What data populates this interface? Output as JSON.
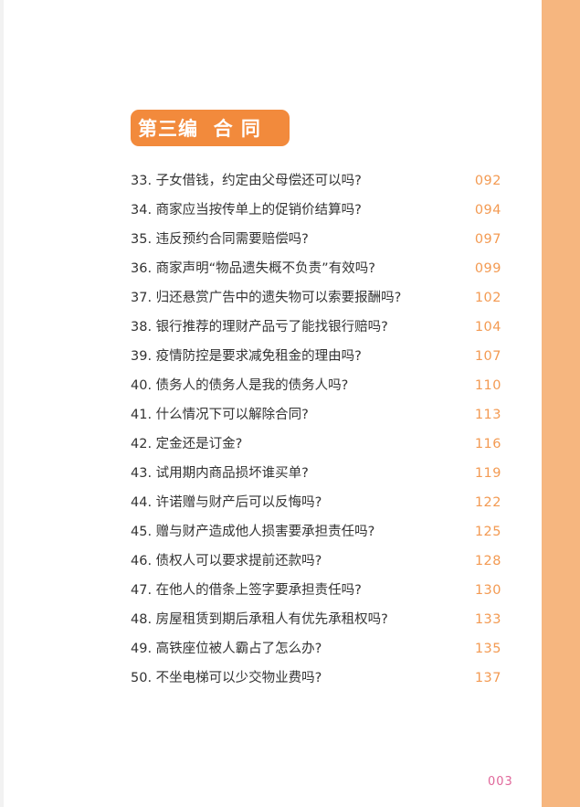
{
  "section": {
    "title": "第三编  合 同"
  },
  "toc": [
    {
      "title": "33. 子女借钱，约定由父母偿还可以吗?",
      "page": "092"
    },
    {
      "title": "34. 商家应当按传单上的促销价结算吗?",
      "page": "094"
    },
    {
      "title": "35. 违反预约合同需要赔偿吗?",
      "page": "097"
    },
    {
      "title": "36. 商家声明“物品遗失概不负责”有效吗?",
      "page": "099"
    },
    {
      "title": "37. 归还悬赏广告中的遗失物可以索要报酬吗?",
      "page": "102"
    },
    {
      "title": "38. 银行推荐的理财产品亏了能找银行赔吗?",
      "page": "104"
    },
    {
      "title": "39. 疫情防控是要求减免租金的理由吗?",
      "page": "107"
    },
    {
      "title": "40. 债务人的债务人是我的债务人吗?",
      "page": "110"
    },
    {
      "title": "41. 什么情况下可以解除合同?",
      "page": "113"
    },
    {
      "title": "42. 定金还是订金?",
      "page": "116"
    },
    {
      "title": "43. 试用期内商品损坏谁买单?",
      "page": "119"
    },
    {
      "title": "44. 许诺赠与财产后可以反悔吗?",
      "page": "122"
    },
    {
      "title": "45. 赠与财产造成他人损害要承担责任吗?",
      "page": "125"
    },
    {
      "title": "46. 债权人可以要求提前还款吗?",
      "page": "128"
    },
    {
      "title": "47. 在他人的借条上签字要承担责任吗?",
      "page": "130"
    },
    {
      "title": "48. 房屋租赁到期后承租人有优先承租权吗?",
      "page": "133"
    },
    {
      "title": "49. 高铁座位被人霸占了怎么办?",
      "page": "135"
    },
    {
      "title": "50. 不坐电梯可以少交物业费吗?",
      "page": "137"
    }
  ],
  "footer": {
    "page_number": "003"
  },
  "colors": {
    "accent": "#f28a3c",
    "side_band": "#f6b67f",
    "page_numbers": "#f39a52",
    "footer_number": "#e0679a"
  }
}
